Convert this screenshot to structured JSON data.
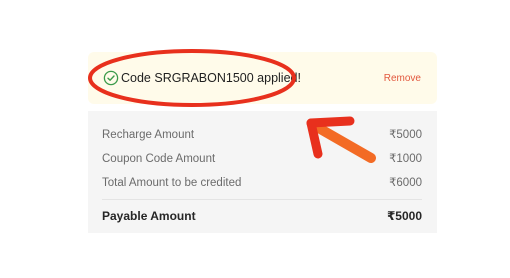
{
  "coupon": {
    "message": "Code SRGRABON1500 applied!",
    "remove_label": "Remove"
  },
  "summary": {
    "rows": [
      {
        "label": "Recharge Amount",
        "value": "₹5000"
      },
      {
        "label": "Coupon Code Amount",
        "value": "₹1000"
      },
      {
        "label": "Total Amount to be credited",
        "value": "₹6000"
      }
    ],
    "payable": {
      "label": "Payable Amount",
      "value": "₹5000"
    }
  },
  "icons": {
    "applied": "check-circle-icon"
  },
  "colors": {
    "banner_bg": "#fffbea",
    "summary_bg": "#f5f5f5",
    "success_green": "#3a9a4a",
    "remove_red": "#e2583e",
    "annotation_red": "#e8301d",
    "annotation_orange": "#f36b25"
  }
}
